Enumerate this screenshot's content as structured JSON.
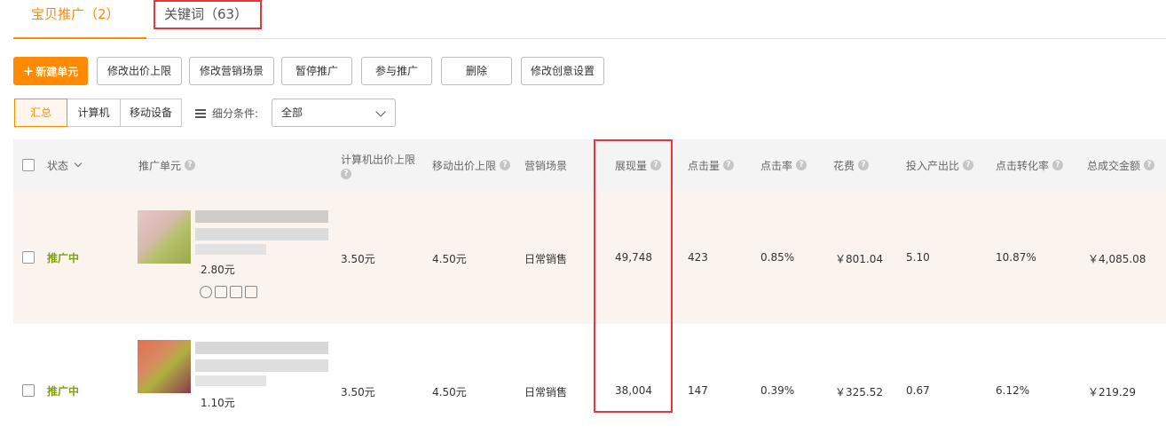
{
  "tabs": [
    {
      "label": "宝贝推广（2）"
    },
    {
      "label": "关键词（63）"
    }
  ],
  "toolbar": {
    "new_unit": "新建单元",
    "edit_bid": "修改出价上限",
    "edit_scene": "修改营销场景",
    "pause": "暂停推广",
    "join": "参与推广",
    "delete": "删除",
    "edit_creative": "修改创意设置"
  },
  "segment": [
    "汇总",
    "计算机",
    "移动设备"
  ],
  "filter": {
    "label": "细分条件:",
    "value": "全部"
  },
  "columns": {
    "status": "状态",
    "unit": "推广单元",
    "pc_bid": "计算机出价上限",
    "mobile_bid": "移动出价上限",
    "scene": "营销场景",
    "impressions": "展现量",
    "clicks": "点击量",
    "ctr": "点击率",
    "cost": "花费",
    "roi": "投入产出比",
    "cvr": "点击转化率",
    "gmv": "总成交金额"
  },
  "rows": [
    {
      "status": "推广中",
      "price": "2.80元",
      "pc_bid": "3.50元",
      "mobile_bid": "4.50元",
      "scene": "日常销售",
      "impressions": "49,748",
      "clicks": "423",
      "ctr": "0.85%",
      "cost": "￥801.04",
      "roi": "5.10",
      "cvr": "10.87%",
      "gmv": "￥4,085.08"
    },
    {
      "status": "推广中",
      "price": "1.10元",
      "pc_bid": "3.50元",
      "mobile_bid": "4.50元",
      "scene": "日常销售",
      "impressions": "38,004",
      "clicks": "147",
      "ctr": "0.39%",
      "cost": "￥325.52",
      "roi": "0.67",
      "cvr": "6.12%",
      "gmv": "￥219.29"
    }
  ]
}
